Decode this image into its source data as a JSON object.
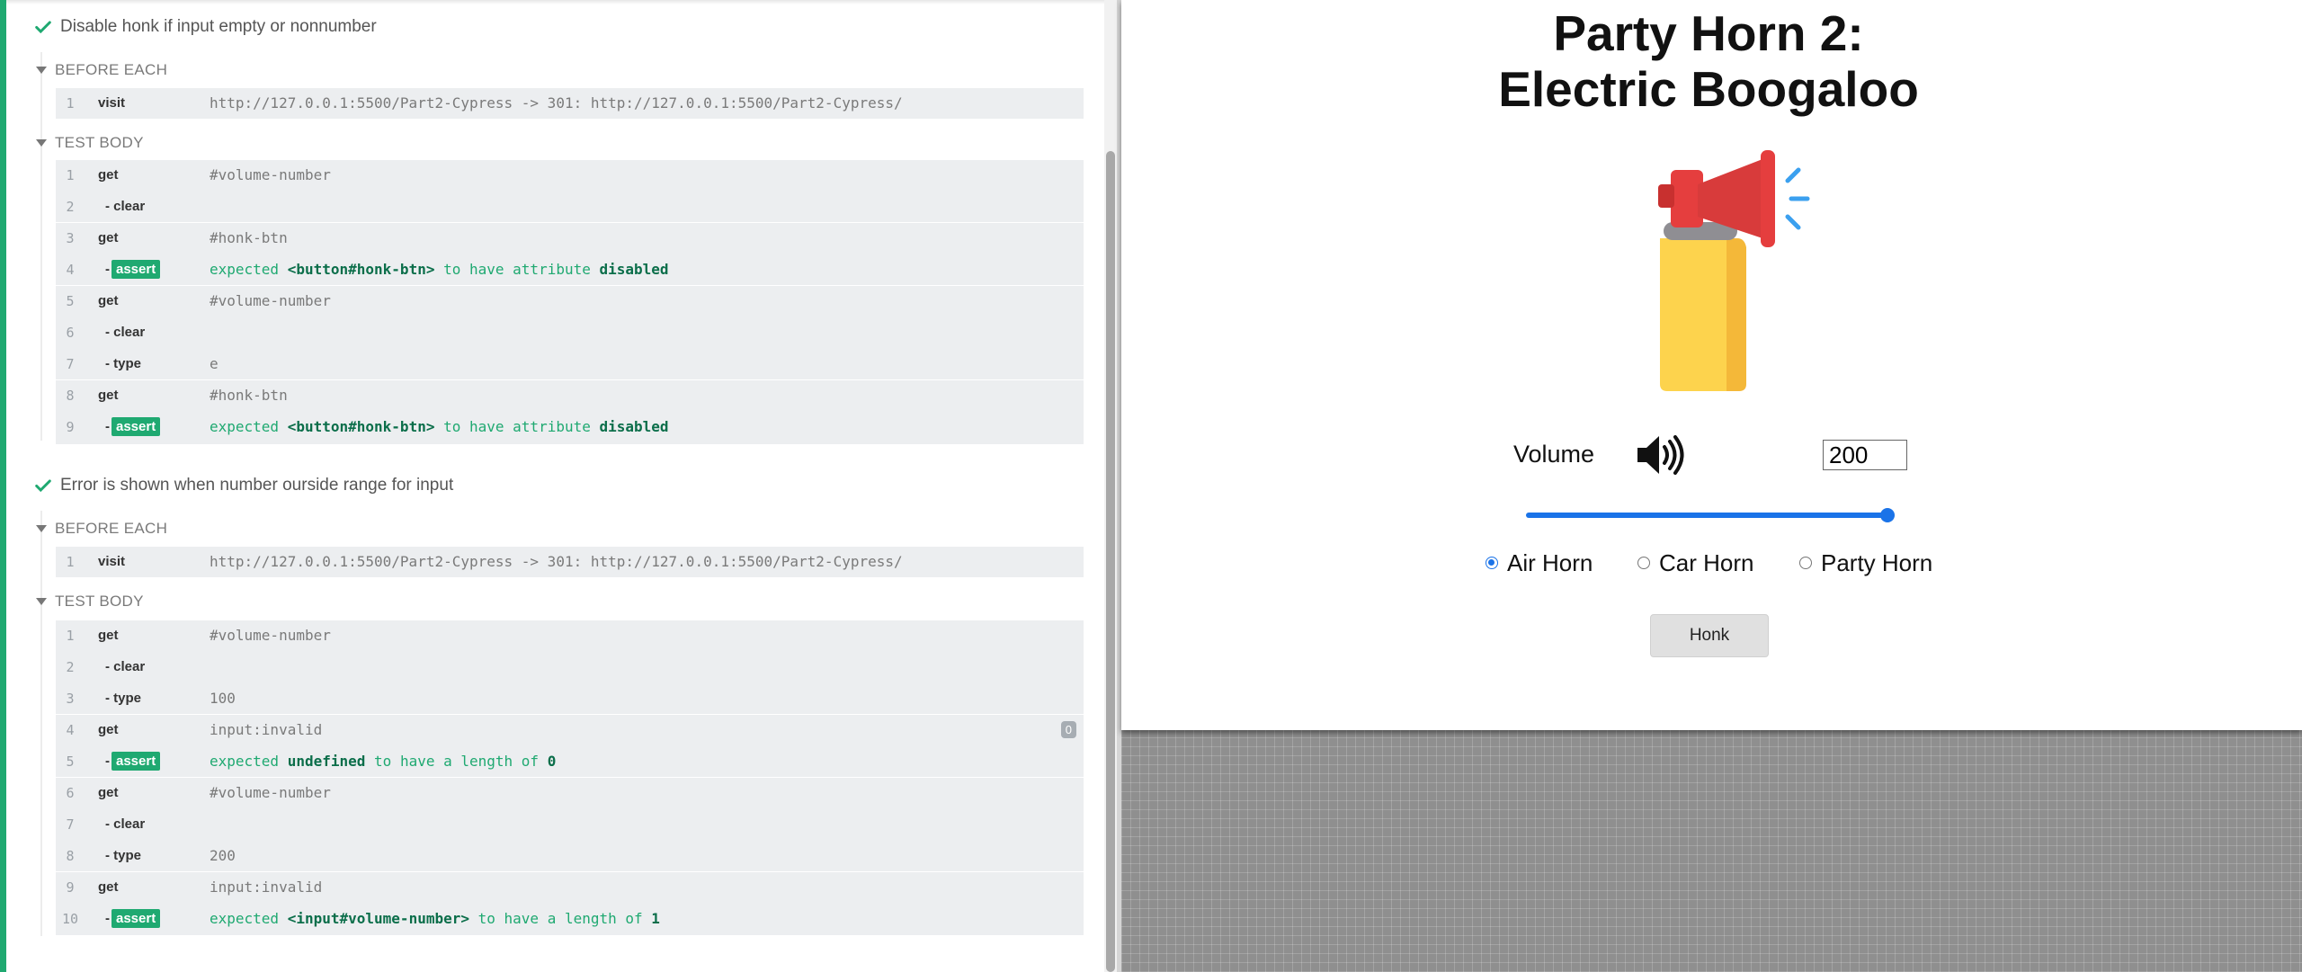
{
  "reporter": {
    "tests": [
      {
        "title": "Disable honk if input empty or nonnumber",
        "before_each_label": "BEFORE EACH",
        "test_body_label": "TEST BODY",
        "before_each": [
          {
            "num": "1",
            "name": "visit",
            "msg": "http://127.0.0.1:5500/Part2-Cypress -> 301: http://127.0.0.1:5500/Part2-Cypress/"
          }
        ],
        "body": [
          {
            "num": "1",
            "name": "get",
            "msg": "#volume-number"
          },
          {
            "num": "2",
            "name": "- clear",
            "msg": ""
          },
          {
            "num": "3",
            "name": "get",
            "msg": "#honk-btn"
          },
          {
            "num": "4",
            "name": "-",
            "badge": "assert",
            "msg_parts": [
              "expected ",
              "<button#honk-btn>",
              " to have attribute ",
              "disabled"
            ]
          },
          {
            "num": "5",
            "name": "get",
            "msg": "#volume-number"
          },
          {
            "num": "6",
            "name": "- clear",
            "msg": ""
          },
          {
            "num": "7",
            "name": "- type",
            "msg": "e"
          },
          {
            "num": "8",
            "name": "get",
            "msg": "#honk-btn"
          },
          {
            "num": "9",
            "name": "-",
            "badge": "assert",
            "msg_parts": [
              "expected ",
              "<button#honk-btn>",
              " to have attribute ",
              "disabled"
            ]
          }
        ]
      },
      {
        "title": "Error is shown when number ourside range for input",
        "before_each_label": "BEFORE EACH",
        "test_body_label": "TEST BODY",
        "before_each": [
          {
            "num": "1",
            "name": "visit",
            "msg": "http://127.0.0.1:5500/Part2-Cypress -> 301: http://127.0.0.1:5500/Part2-Cypress/"
          }
        ],
        "body": [
          {
            "num": "1",
            "name": "get",
            "msg": "#volume-number"
          },
          {
            "num": "2",
            "name": "- clear",
            "msg": ""
          },
          {
            "num": "3",
            "name": "- type",
            "msg": "100"
          },
          {
            "num": "4",
            "name": "get",
            "msg": "input:invalid",
            "count": "0"
          },
          {
            "num": "5",
            "name": "-",
            "badge": "assert",
            "msg_parts": [
              "expected ",
              "undefined",
              " to have a length of ",
              "0"
            ]
          },
          {
            "num": "6",
            "name": "get",
            "msg": "#volume-number"
          },
          {
            "num": "7",
            "name": "- clear",
            "msg": ""
          },
          {
            "num": "8",
            "name": "- type",
            "msg": "200"
          },
          {
            "num": "9",
            "name": "get",
            "msg": "input:invalid"
          },
          {
            "num": "10",
            "name": "-",
            "badge": "assert",
            "msg_parts": [
              "expected ",
              "<input#volume-number>",
              " to have a length of ",
              "1"
            ]
          }
        ]
      }
    ]
  },
  "app": {
    "title_line1": "Party Horn 2:",
    "title_line2": "Electric Boogaloo",
    "horn_icon": "air-horn-icon",
    "volume_label": "Volume",
    "volume_icon": "speaker-high-icon",
    "volume_value": "200",
    "slider_fraction": 1.0,
    "radios": [
      {
        "label": "Air Horn",
        "checked": true
      },
      {
        "label": "Car Horn",
        "checked": false
      },
      {
        "label": "Party Horn",
        "checked": false
      }
    ],
    "honk_label": "Honk"
  },
  "colors": {
    "pass_green": "#1fa971",
    "slider_blue": "#1a73e8",
    "horn_red": "#d83b3b",
    "horn_yellow": "#fdd34d"
  }
}
